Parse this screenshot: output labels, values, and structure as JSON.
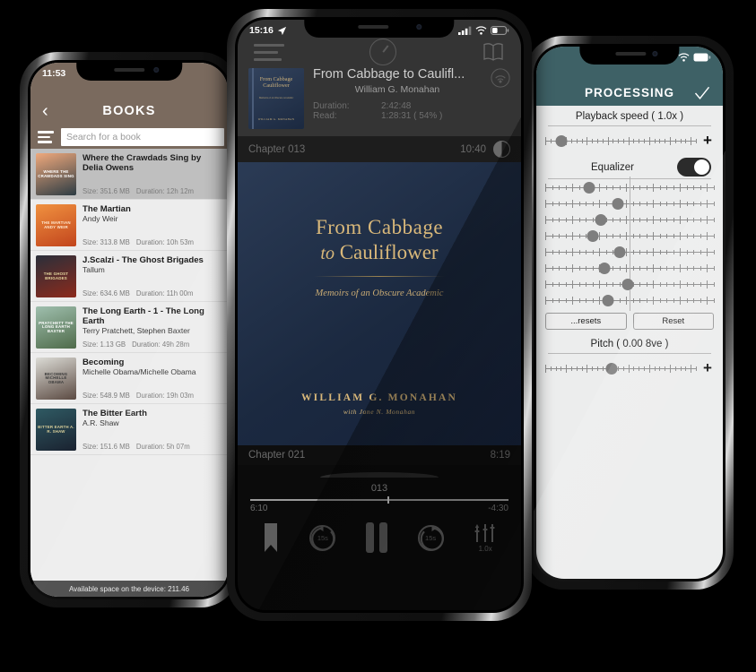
{
  "left_phone": {
    "status_time": "11:53",
    "header": {
      "title": "BOOKS",
      "back_icon": "chevron-left-icon",
      "menu_icon": "hamburger-icon"
    },
    "search": {
      "placeholder": "Search for a book",
      "value": ""
    },
    "books": [
      {
        "title": "Where the Crawdads Sing by Delia Owens",
        "author": "",
        "size": "Size: 351.6 MB",
        "duration": "Duration: 12h 12m",
        "selected": true,
        "cover_text": "WHERE THE CRAWDADS SING",
        "cover_c1": "#f0a97c",
        "cover_c2": "#2d3c44",
        "cover_fg": "#ffffff"
      },
      {
        "title": "The Martian",
        "author": "Andy Weir",
        "size": "Size: 313.8 MB",
        "duration": "Duration: 10h 53m",
        "selected": false,
        "cover_text": "THE MARTIAN ANDY WEIR",
        "cover_c1": "#f0913f",
        "cover_c2": "#c2451d",
        "cover_fg": "#ffe9d0"
      },
      {
        "title": "J.Scalzi - The Ghost Brigades",
        "author": "Tallum",
        "size": "Size: 634.6 MB",
        "duration": "Duration: 11h 00m",
        "selected": false,
        "cover_text": "THE GHOST BRIGADES",
        "cover_c1": "#2a2f3a",
        "cover_c2": "#8c2a1c",
        "cover_fg": "#e8d9a0"
      },
      {
        "title": "The Long Earth - 1 - The Long Earth",
        "author": "Terry Pratchett, Stephen Baxter",
        "size": "Size: 1.13 GB",
        "duration": "Duration: 49h 28m",
        "selected": false,
        "cover_text": "PRATCHETT THE LONG EARTH BAXTER",
        "cover_c1": "#9fbfae",
        "cover_c2": "#4f6b4a",
        "cover_fg": "#ffffff"
      },
      {
        "title": "Becoming",
        "author": "Michelle Obama/Michelle Obama",
        "size": "Size: 548.9 MB",
        "duration": "Duration: 19h 03m",
        "selected": false,
        "cover_text": "BECOMING MICHELLE OBAMA",
        "cover_c1": "#dcdcd6",
        "cover_c2": "#5b4a42",
        "cover_fg": "#3a3a3a"
      },
      {
        "title": "The Bitter Earth",
        "author": "A.R. Shaw",
        "size": "Size: 151.6 MB",
        "duration": "Duration: 5h 07m",
        "selected": false,
        "cover_text": "BITTER EARTH A. R. SHAW",
        "cover_c1": "#2f5a63",
        "cover_c2": "#1a2230",
        "cover_fg": "#d9cf9a"
      }
    ],
    "footer": "Available space on the device: 211.46"
  },
  "center_phone": {
    "status_time": "15:16",
    "status_location_icon": "location-arrow-icon",
    "nav": {
      "menu_icon": "hamburger-icon",
      "sleep_timer_icon": "sleep-timer-icon",
      "book_icon": "open-book-icon"
    },
    "now_playing": {
      "title": "From Cabbage to Caulifl...",
      "author": "William G. Monahan",
      "duration_label": "Duration:",
      "duration_value": "2:42:48",
      "read_label": "Read:",
      "read_value": "1:28:31 ( 54% )",
      "airplay_icon": "airplay-icon"
    },
    "chapter_top": {
      "name": "Chapter 013",
      "time": "10:40",
      "knob_icon": "half-circle-icon"
    },
    "cover": {
      "title_line1": "From Cabbage",
      "title_line2_italic": "to",
      "title_line2": "Cauliflower",
      "subtitle": "Memoirs of an Obscure Academic",
      "author": "WILLIAM G. MONAHAN",
      "author2": "with Jane N. Monahan",
      "gold": "#d9b87a",
      "bg": "#1b2940"
    },
    "chapter_bottom": {
      "name": "Chapter 021",
      "time": "8:19"
    },
    "seek": {
      "number": "013",
      "elapsed": "6:10",
      "remaining": "-4:30",
      "progress_pct": 53
    },
    "controls": {
      "bookmark_icon": "bookmark-icon",
      "rewind_label": "15s",
      "pause_icon": "pause-icon",
      "forward_label": "15s",
      "equalizer_icon": "equalizer-icon",
      "speed_label": "1.0x"
    }
  },
  "right_phone": {
    "header": {
      "title": "PROCESSING",
      "confirm_icon": "checkmark-icon"
    },
    "playback_speed": {
      "label": "Playback speed ( 1.0x )",
      "thumb_pct": 11,
      "plus_label": "+"
    },
    "equalizer": {
      "label": "Equalizer",
      "enabled": true
    },
    "eq_bands": [
      {
        "thumb_pct": 26
      },
      {
        "thumb_pct": 43
      },
      {
        "thumb_pct": 33
      },
      {
        "thumb_pct": 28
      },
      {
        "thumb_pct": 44
      },
      {
        "thumb_pct": 35
      },
      {
        "thumb_pct": 49
      },
      {
        "thumb_pct": 37
      }
    ],
    "buttons": {
      "presets": "...resets",
      "reset": "Reset"
    },
    "pitch": {
      "label": "Pitch ( 0.00 8ve )",
      "thumb_pct": 44,
      "plus_label": "+"
    }
  }
}
